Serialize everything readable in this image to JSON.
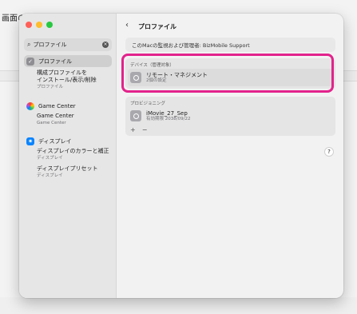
{
  "background": {
    "title": "画面の"
  },
  "window": {
    "search": {
      "value": "プロファイル"
    },
    "sidebar": {
      "items": [
        {
          "label": "プロファイル"
        },
        {
          "label": "Game Center"
        },
        {
          "label": "ディスプレイ"
        }
      ],
      "subs": [
        {
          "line1": "構成プロファイルを",
          "line2": "インストール/表示/削除",
          "minor": "プロファイル"
        },
        {
          "line1": "Game Center",
          "minor": "Game Center"
        },
        {
          "line1": "ディスプレイのカラーと補正",
          "minor": "ディスプレイ"
        },
        {
          "line1": "ディスプレイプリセット",
          "minor": "ディスプレイ"
        }
      ]
    },
    "main": {
      "back": "‹",
      "title": "プロファイル",
      "banner": "このMacの監視および管理者: BizMobile Support",
      "device_group": {
        "header": "デバイス（管理対象）",
        "row": {
          "title": "リモート・マネジメント",
          "sub": "2個の設定"
        }
      },
      "prov_group": {
        "header": "プロビジョニング",
        "row": {
          "title": "iMovie_27_Sep",
          "sub": "有効期限 2038/09/22"
        }
      },
      "plus": "+",
      "minus": "−",
      "help": "?"
    }
  },
  "colors": {
    "highlight": "#e2238c"
  }
}
